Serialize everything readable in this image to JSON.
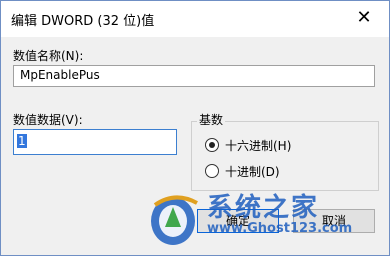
{
  "window": {
    "title": "编辑 DWORD (32 位)值",
    "close_glyph": "✕"
  },
  "value_name": {
    "label": "数值名称(N):",
    "value": "MpEnablePus"
  },
  "value_data": {
    "label": "数值数据(V):",
    "value": "1"
  },
  "base": {
    "title": "基数",
    "options": [
      {
        "label": "十六进制(H)",
        "selected": true
      },
      {
        "label": "十进制(D)",
        "selected": false
      }
    ]
  },
  "buttons": {
    "ok": "确定",
    "cancel": "取消"
  },
  "watermark": {
    "text": "系统之家",
    "url": "www.Ghost123.com"
  },
  "colors": {
    "accent": "#3377dd",
    "watermark": "#1f5fbf"
  }
}
